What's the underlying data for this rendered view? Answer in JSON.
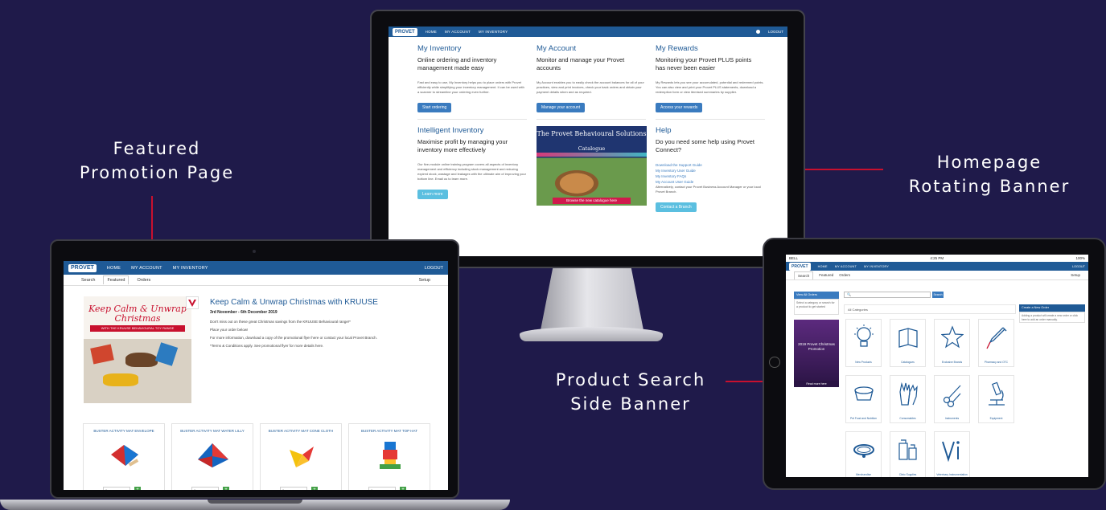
{
  "callouts": {
    "featured": [
      "Featured",
      "Promotion Page"
    ],
    "homepage": [
      "Homepage",
      "Rotating Banner"
    ],
    "product": [
      "Product Search",
      "Side Banner"
    ]
  },
  "colors": {
    "background": "#1f1a4a",
    "brand_blue": "#1f5a96",
    "accent_red": "#c8102e",
    "add_green": "#43a047"
  },
  "nav": {
    "logo": "PROVET",
    "home": "HOME",
    "account": "MY ACCOUNT",
    "inventory": "MY INVENTORY",
    "logout": "LOGOUT"
  },
  "monitor": {
    "inventory": {
      "title": "My Inventory",
      "subtitle": "Online ordering and inventory management made easy",
      "body": "Fast and easy to use, My Inventory helps you to place orders with Provet efficiently while simplifying your inventory management. It can be used with a scanner to streamline your ordering even further.",
      "button": "Start ordering"
    },
    "account": {
      "title": "My Account",
      "subtitle": "Monitor and manage your Provet accounts",
      "body": "My Account enables you to easily check the account balances for all of your practices, view and print invoices, check your back orders and obtain your payment details when and as required.",
      "button": "Manage your account"
    },
    "rewards": {
      "title": "My Rewards",
      "subtitle": "Monitoring your Provet PLUS points has never been easier",
      "body": "My Rewards lets you see your accumulated, potential and redeemed points. You can also view and print your Provet PLUS statements, download a redemption form or view itemised summaries by supplier.",
      "button": "Access your rewards"
    },
    "intelligent": {
      "title": "Intelligent Inventory",
      "subtitle": "Maximise profit by managing your inventory more effectively",
      "body": "Our five-module online training program covers all aspects of inventory management and efficiency including stock management and reducing expired stock, wastage and leakages with the ultimate aim of improving your bottom line. Email us to learn more.",
      "button": "Learn more"
    },
    "banner": {
      "title": "The Provet Behavioural Solutions",
      "subtitle": "Catalogue",
      "cta": "Browse the new catalogue here"
    },
    "help": {
      "title": "Help",
      "subtitle": "Do you need some help using Provet Connect?",
      "links": [
        "Download the Support Guide",
        "My Inventory User Guide",
        "My Inventory FAQs",
        "My Account User Guide"
      ],
      "body": "Alternatively, contact your Provet Business Account Manager or your local Provet Branch.",
      "button": "Contact a Branch"
    }
  },
  "laptop": {
    "tabs": [
      "Search",
      "Featured",
      "Orders"
    ],
    "settings": "Setup",
    "art": {
      "headline": "Keep Calm & Unwrap Christmas",
      "bar": "WITH THE KRUUSE BEHAVIOURAL TOY RANGE"
    },
    "promo": {
      "title": "Keep Calm & Unwrap Christmas with KRUUSE",
      "dates": "3rd November - 6th December 2019",
      "line1": "Don't miss out on these great Christmas savings from the KRUUSE Behavioural range!*",
      "line2": "Place your order below!",
      "line3": "For more information, download a copy of the promotional flyer here or contact your local Provet Branch.",
      "line4": "*Terms & Conditions apply. See promotional flyer for more details here."
    },
    "products": [
      {
        "name": "BUSTER ACTIVITY MAT ENVELOPE",
        "qty": "0"
      },
      {
        "name": "BUSTER ACTIVITY MAT WATER LILLY",
        "qty": "0"
      },
      {
        "name": "BUSTER ACTIVITY MAT CONE CLOTH",
        "qty": "0"
      },
      {
        "name": "BUSTER ACTIVITY MAT TOP HAT",
        "qty": "0"
      }
    ]
  },
  "tablet": {
    "status": {
      "carrier": "BELL",
      "time": "4:25 PM",
      "battery": "100%"
    },
    "tabs": [
      "Search",
      "Featured",
      "Orders"
    ],
    "settings": "Setup",
    "side_head": "View All Orders",
    "side_note": "Select a category or search for a product to get started",
    "side_banner": "2019 Provet Christmas Promotion",
    "side_banner_foot": "Read more here",
    "search_button": "Search",
    "category_heading": "All Categories",
    "cart_head": "Create a New Order",
    "cart_body": "Adding a product will create a new order or click here to add an order manually.",
    "categories": [
      {
        "label": "New Products",
        "icon": "lightbulb-icon"
      },
      {
        "label": "Catalogues",
        "icon": "catalogue-icon"
      },
      {
        "label": "Exclusive Brands",
        "icon": "star-icon"
      },
      {
        "label": "Pharmacy and OTC",
        "icon": "syringe-icon"
      },
      {
        "label": "Pet Food and Nutrition",
        "icon": "bowl-icon"
      },
      {
        "label": "Consumables",
        "icon": "gloves-icon"
      },
      {
        "label": "Instruments",
        "icon": "scissors-icon"
      },
      {
        "label": "Equipment",
        "icon": "microscope-icon"
      },
      {
        "label": "Merchandise",
        "icon": "collar-icon"
      },
      {
        "label": "Clinic Supplies",
        "icon": "supplies-icon"
      },
      {
        "label": "Veterinary Instrumentation",
        "icon": "vi-icon"
      }
    ]
  }
}
